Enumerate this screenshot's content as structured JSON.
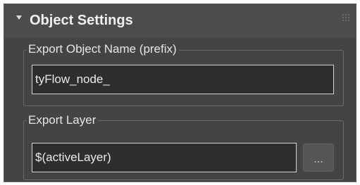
{
  "rollout": {
    "title": "Object Settings"
  },
  "export_object_name": {
    "label": "Export Object Name (prefix)",
    "value": "tyFlow_node_"
  },
  "export_layer": {
    "label": "Export Layer",
    "value": "$(activeLayer)",
    "browse_label": "..."
  },
  "icons": {
    "collapse": "triangle-down-icon",
    "grip": "drag-grip-icon"
  },
  "colors": {
    "panel_bg": "#444444",
    "field_bg": "#2e2e2e",
    "field_border": "#d4d4d4",
    "text": "#eaeaea"
  }
}
